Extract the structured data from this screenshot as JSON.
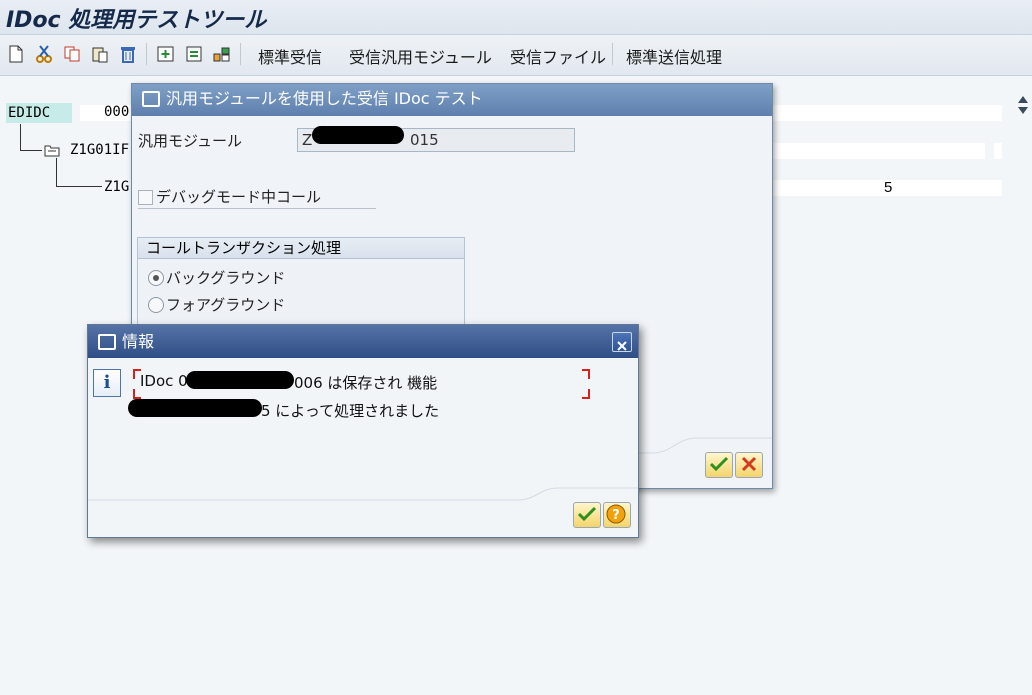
{
  "app": {
    "title": "IDoc 処理用テストツール"
  },
  "toolbar": {
    "icons": [
      "new-document-icon",
      "cut-icon",
      "copy-icon",
      "paste-icon",
      "delete-icon",
      "insert-icon",
      "insert-below-icon",
      "segment-icon"
    ],
    "buttons": [
      "標準受信",
      "受信汎用モジュール",
      "受信ファイル",
      "標準送信処理"
    ]
  },
  "tree": {
    "root": "EDIDC",
    "root_value": "000",
    "child": "Z1G01IF",
    "grandchild": "Z1G",
    "grandchild_value": "5"
  },
  "dialog_fm": {
    "title": "汎用モジュールを使用した受信 IDoc テスト",
    "fm_label": "汎用モジュール",
    "fm_value_prefix": "Z",
    "fm_value_suffix": "015",
    "debug_label": "デバッグモード中コール",
    "call_tx_group": "コールトランザクション処理",
    "option_background": "バックグラウンド",
    "option_foreground": "フォアグラウンド"
  },
  "dialog_info": {
    "title": "情報",
    "line1_prefix": "IDoc 0",
    "line1_suffix": "006 は保存され 機能",
    "line2_suffix": "5 によって処理されました"
  },
  "colors": {
    "accent": "#2f4e86",
    "ok": "#3a9a2a",
    "cancel": "#d03a1e"
  }
}
